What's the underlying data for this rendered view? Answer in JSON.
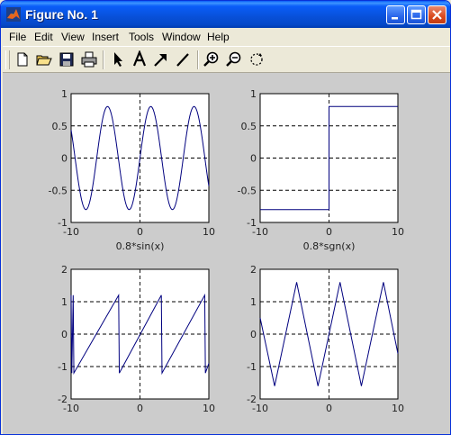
{
  "window": {
    "title": "Figure No. 1",
    "accent": "#0a5df8"
  },
  "title_buttons": [
    "minimize-icon",
    "maximize-icon",
    "close-icon"
  ],
  "menu": [
    "File",
    "Edit",
    "View",
    "Insert",
    "Tools",
    "Window",
    "Help"
  ],
  "toolbar_icons": [
    "new-figure-icon",
    "open-file-icon",
    "save-icon",
    "print-icon",
    "select-arrow-icon",
    "insert-text-icon",
    "insert-arrow-icon",
    "insert-line-icon",
    "zoom-in-icon",
    "zoom-out-icon",
    "rotate-3d-icon"
  ],
  "chart_data": [
    {
      "type": "line",
      "xlabel": "0.8*sin(x)",
      "xlim": [
        -10,
        10
      ],
      "ylim": [
        -1,
        1
      ],
      "xticks": [
        "-10",
        "0",
        "10"
      ],
      "yticks": [
        "1",
        "0.5",
        "0",
        "-0.5",
        "-1"
      ],
      "grid": "dashed",
      "series": [
        {
          "function": "0.8*sin(x)",
          "color": "#00007f"
        }
      ]
    },
    {
      "type": "line",
      "xlabel": "0.8*sgn(x)",
      "xlim": [
        -10,
        10
      ],
      "ylim": [
        -1,
        1
      ],
      "xticks": [
        "-10",
        "0",
        "10"
      ],
      "yticks": [
        "1",
        "0.5",
        "0",
        "-0.5",
        "-1"
      ],
      "grid": "dashed",
      "series": [
        {
          "x": [
            -10,
            0,
            0,
            10
          ],
          "y": [
            -0.8,
            -0.8,
            0.8,
            0.8
          ],
          "color": "#00007f"
        }
      ]
    },
    {
      "type": "line",
      "xlabel": "",
      "xlim": [
        -10,
        10
      ],
      "ylim": [
        -2,
        2
      ],
      "xticks": [
        "-10",
        "0",
        "10"
      ],
      "yticks": [
        "2",
        "1",
        "0",
        "-1",
        "-2"
      ],
      "grid": "dashed",
      "series": [
        {
          "x": [
            -10,
            -9.9,
            -9.7,
            -9.6,
            -3.1,
            -3.0,
            3.1,
            3.2,
            9.4,
            9.5,
            10
          ],
          "y": [
            1.2,
            -1.2,
            1.2,
            -1.2,
            1.2,
            -1.2,
            1.2,
            -1.2,
            1.2,
            -1.2,
            -0.9
          ],
          "color": "#00007f"
        }
      ]
    },
    {
      "type": "line",
      "xlabel": "",
      "xlim": [
        -10,
        10
      ],
      "ylim": [
        -2,
        2
      ],
      "xticks": [
        "-10",
        "0",
        "10"
      ],
      "yticks": [
        "2",
        "1",
        "0",
        "-1",
        "-2"
      ],
      "grid": "dashed",
      "series": [
        {
          "x": [
            -10,
            -7.9,
            -4.7,
            -1.6,
            1.6,
            4.7,
            7.9,
            10
          ],
          "y": [
            0.5,
            -1.6,
            1.6,
            -1.6,
            1.6,
            -1.6,
            1.6,
            -0.6
          ],
          "color": "#00007f"
        }
      ]
    }
  ]
}
